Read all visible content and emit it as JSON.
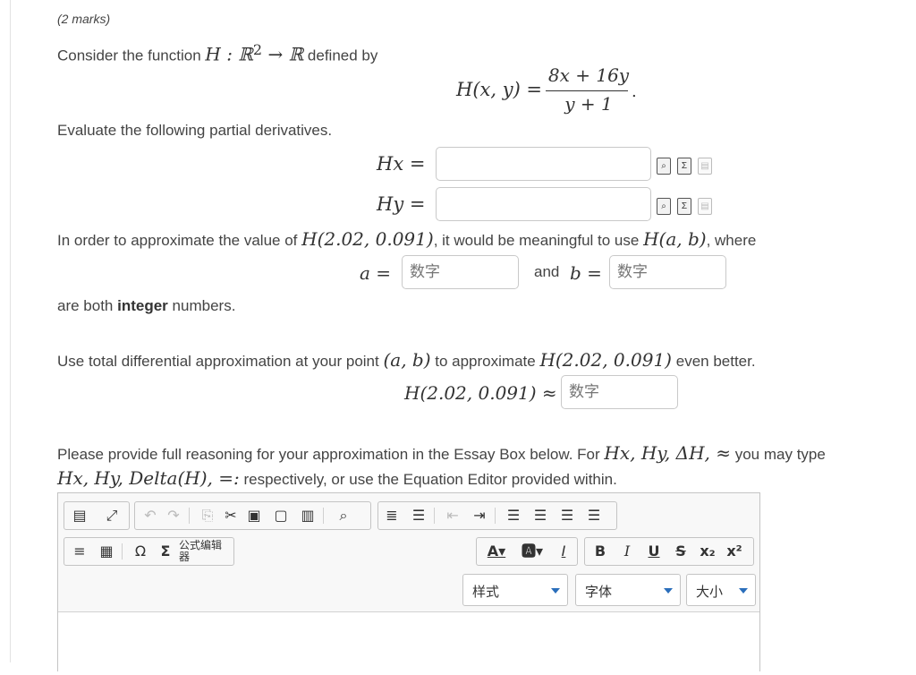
{
  "question": {
    "marks": "(2 marks)",
    "intro_text": "Consider the function",
    "intro_math": "H : ℝ",
    "intro_sup": "2",
    "intro_math2": " → ℝ",
    "intro_tail": "defined by",
    "def_lhs": "H(x, y) =",
    "def_num": "8x + 16y",
    "def_den": "y + 1",
    "def_period": ".",
    "eval_text": "Evaluate the following partial derivatives.",
    "hx_label": "Hx =",
    "hx_value": "",
    "hy_label": "Hy =",
    "hy_value": "",
    "approx_text_1": "In order to approximate the value of",
    "approx_math_1": "H(2.02, 0.091)",
    "approx_text_2": ", it would be meaningful to use",
    "approx_math_2": "H(a, b)",
    "approx_text_3": ", where",
    "a_label": "a =",
    "a_placeholder": "数字",
    "and_text": "and",
    "b_label": "b =",
    "b_placeholder": "数字",
    "integer_text_1": "are both",
    "integer_bold": "integer",
    "integer_text_2": "numbers.",
    "total_text_1": "Use total differential approximation at your point",
    "total_math_1": "(a, b)",
    "total_text_2": "to approximate",
    "total_math_2": "H(2.02, 0.091)",
    "total_text_3": "even better.",
    "final_label": "H(2.02, 0.091) ≈",
    "final_placeholder": "数字",
    "essay_text_1": "Please provide full reasoning for your approximation in the Essay Box below. For",
    "essay_math_1": "Hx, Hy, ΔH, ≈",
    "essay_text_2": "you may type",
    "essay_math_2": "Hx, Hy, Delta(H), =:",
    "essay_text_3": "respectively, or use the Equation Editor provided within."
  },
  "icons": {
    "preview": "preview-icon",
    "equation": "equation-icon",
    "paste": "paste-icon"
  },
  "editor": {
    "formula_editor_label": "公式编辑器",
    "style_label": "样式",
    "font_label": "字体",
    "size_label": "大小",
    "bold_label": "B",
    "italic_label": "I",
    "underline_label": "U",
    "strike_label": "S",
    "content": ""
  },
  "colors": {
    "accent": "#2a6ebb",
    "border": "#c4c4c4",
    "text": "#333333"
  }
}
